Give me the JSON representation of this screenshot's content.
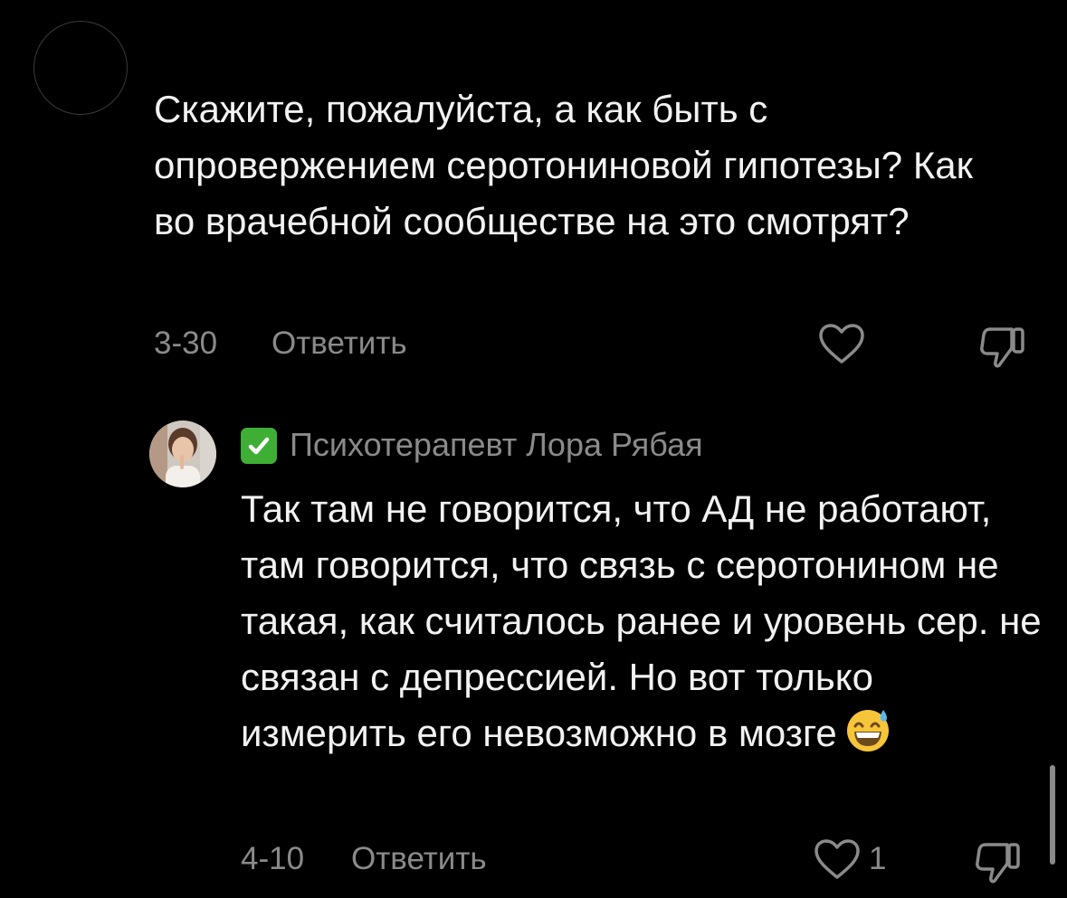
{
  "comment": {
    "text": "Скажите, пожалуйста, а как быть с опровержением серотониновой гипотезы? Как во врачебной сообществе на это смотрят?",
    "date": "3-30",
    "reply_label": "Ответить"
  },
  "reply": {
    "author": "Психотерапевт Лора Рябая",
    "text": "Так там не говорится, что АД не работают, там говорится, что связь с серотонином не такая, как считалось ранее и уровень сер. не связан с депрессией. Но вот только измерить его невозможно в мозге",
    "emoji": "grinning-sweat-emoji",
    "date": "4-10",
    "reply_label": "Ответить",
    "like_count": "1"
  },
  "colors": {
    "background": "#000000",
    "text": "#f2f2f2",
    "secondary_text": "#8a8a8a",
    "verified_badge": "#3fae35"
  },
  "icons": [
    "heart-icon",
    "thumbs-down-icon",
    "verified-check-icon"
  ]
}
